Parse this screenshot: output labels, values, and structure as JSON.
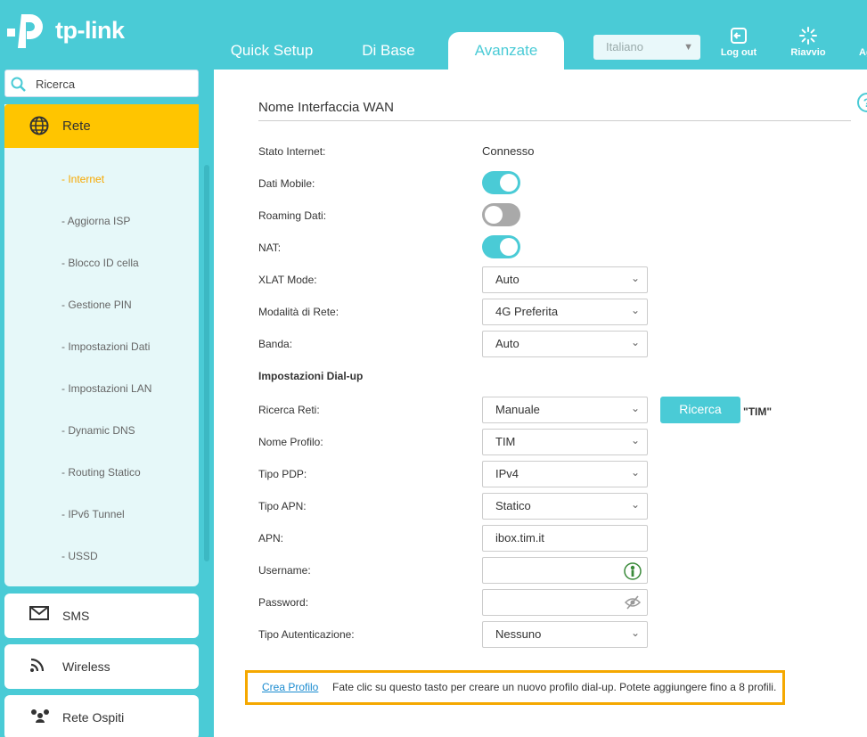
{
  "brand": {
    "name": "tp-link"
  },
  "nav": {
    "tabs": [
      {
        "label": "Quick Setup"
      },
      {
        "label": "Di Base"
      },
      {
        "label": "Avanzate"
      }
    ],
    "language": "Italiano",
    "actions": [
      {
        "label": "Log out",
        "icon": "logout-icon"
      },
      {
        "label": "Riavvio",
        "icon": "reboot-icon"
      },
      {
        "label": "Ag",
        "icon": "update-icon"
      }
    ]
  },
  "sidebar": {
    "search_placeholder": "Ricerca",
    "section": {
      "label": "Rete",
      "icon": "globe-icon"
    },
    "items": [
      {
        "label": "- Internet"
      },
      {
        "label": "- Aggiorna ISP"
      },
      {
        "label": "- Blocco ID cella"
      },
      {
        "label": "- Gestione PIN"
      },
      {
        "label": "- Impostazioni Dati"
      },
      {
        "label": "- Impostazioni LAN"
      },
      {
        "label": "- Dynamic DNS"
      },
      {
        "label": "- Routing Statico"
      },
      {
        "label": "- IPv6 Tunnel"
      },
      {
        "label": "- USSD"
      }
    ],
    "cards": [
      {
        "label": "SMS",
        "icon": "envelope-icon"
      },
      {
        "label": "Wireless",
        "icon": "wifi-icon"
      },
      {
        "label": "Rete Ospiti",
        "icon": "guests-icon"
      }
    ]
  },
  "main": {
    "title": "Nome Interfaccia WAN",
    "fields": {
      "stato_internet": {
        "label": "Stato Internet:",
        "value": "Connesso"
      },
      "dati_mobile": {
        "label": "Dati Mobile:",
        "on": true
      },
      "roaming": {
        "label": "Roaming Dati:",
        "on": false
      },
      "nat": {
        "label": "NAT:",
        "on": true
      },
      "xlat": {
        "label": "XLAT Mode:",
        "value": "Auto"
      },
      "modalita": {
        "label": "Modalità di Rete:",
        "value": "4G Preferita"
      },
      "banda": {
        "label": "Banda:",
        "value": "Auto"
      },
      "dialup_heading": "Impostazioni Dial-up",
      "ricerca_reti": {
        "label": "Ricerca Reti:",
        "value": "Manuale"
      },
      "ricerca_button": "Ricerca",
      "network_name": "\"TIM\"",
      "nome_profilo": {
        "label": "Nome Profilo:",
        "value": "TIM"
      },
      "tipo_pdp": {
        "label": "Tipo PDP:",
        "value": "IPv4"
      },
      "tipo_apn": {
        "label": "Tipo APN:",
        "value": "Statico"
      },
      "apn": {
        "label": "APN:",
        "value": "ibox.tim.it"
      },
      "username": {
        "label": "Username:",
        "value": ""
      },
      "password": {
        "label": "Password:",
        "value": ""
      },
      "auth": {
        "label": "Tipo Autenticazione:",
        "value": "Nessuno"
      }
    },
    "create_profile_link": "Crea Profilo",
    "hint": "Fate clic su questo tasto per creare un nuovo profilo dial-up. Potete aggiungere fino a 8 profili."
  },
  "colors": {
    "accent": "#4acbd6",
    "active": "#ffc500",
    "highlight": "#f5a800"
  }
}
